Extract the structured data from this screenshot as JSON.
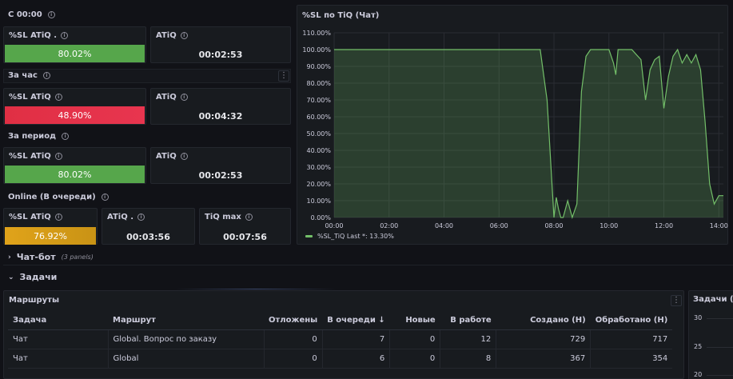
{
  "sections": {
    "now": {
      "title": "С 00:00"
    },
    "hour": {
      "title": "За час"
    },
    "period": {
      "title": "За период"
    },
    "online": {
      "title": "Online (В очереди)"
    }
  },
  "stats": {
    "now_sl": {
      "label": "%SL ATiQ .",
      "value": "80.02%",
      "color": "#56a64b"
    },
    "now_atiq": {
      "label": "ATiQ",
      "value": "00:02:53"
    },
    "hour_sl": {
      "label": "%SL ATiQ",
      "value": "48.90%",
      "color": "#e02f44"
    },
    "hour_atiq": {
      "label": "ATiQ",
      "value": "00:04:32"
    },
    "period_sl": {
      "label": "%SL ATiQ",
      "value": "80.02%",
      "color": "#56a64b"
    },
    "period_atiq": {
      "label": "ATiQ",
      "value": "00:02:53"
    },
    "online_sl": {
      "label": "%SL ATiQ",
      "value": "76.92%",
      "color": "#e0a31a"
    },
    "online_atiq": {
      "label": "ATiQ .",
      "value": "00:03:56"
    },
    "online_tiqmax": {
      "label": "TiQ max",
      "value": "00:07:56"
    }
  },
  "chart_panel": {
    "title": "%SL по TiQ (Чат)",
    "legend": "%SL_TiQ  Last *: 13.30%"
  },
  "chart_data": {
    "type": "area",
    "series": [
      {
        "name": "%SL_TiQ",
        "color": "#73bf69"
      }
    ],
    "x": [
      "00:00",
      "00:30",
      "01:00",
      "01:30",
      "02:00",
      "02:30",
      "03:00",
      "03:30",
      "04:00",
      "04:30",
      "05:00",
      "05:30",
      "06:00",
      "06:30",
      "07:00",
      "07:30",
      "07:45",
      "08:00",
      "08:05",
      "08:10",
      "08:15",
      "08:20",
      "08:30",
      "08:40",
      "08:50",
      "09:00",
      "09:10",
      "09:20",
      "09:30",
      "09:40",
      "09:50",
      "10:00",
      "10:10",
      "10:15",
      "10:20",
      "10:30",
      "10:40",
      "10:50",
      "11:00",
      "11:10",
      "11:20",
      "11:30",
      "11:40",
      "11:50",
      "12:00",
      "12:10",
      "12:20",
      "12:30",
      "12:40",
      "12:50",
      "13:00",
      "13:10",
      "13:20",
      "13:30",
      "13:40",
      "13:50",
      "14:00",
      "14:10"
    ],
    "y": [
      100,
      100,
      100,
      100,
      100,
      100,
      100,
      100,
      100,
      100,
      100,
      100,
      100,
      100,
      100,
      100,
      70,
      0,
      12,
      5,
      0,
      0,
      10,
      0,
      8,
      75,
      96,
      100,
      100,
      100,
      100,
      100,
      92,
      85,
      100,
      100,
      100,
      100,
      97,
      94,
      70,
      88,
      94,
      96,
      65,
      84,
      96,
      100,
      92,
      97,
      92,
      97,
      88,
      57,
      20,
      8,
      13,
      13
    ],
    "y_ticks": [
      "0.00%",
      "10.00%",
      "20.00%",
      "30.00%",
      "40.00%",
      "50.00%",
      "60.00%",
      "70.00%",
      "80.00%",
      "90.00%",
      "100.00%",
      "110.00%"
    ],
    "x_ticks": [
      "00:00",
      "02:00",
      "04:00",
      "06:00",
      "08:00",
      "10:00",
      "12:00",
      "14:00"
    ],
    "ylim": [
      0,
      110
    ],
    "grid": true
  },
  "rows": {
    "chatbot": {
      "title": "Чат-бот",
      "meta": "(3 panels)"
    },
    "tasks": {
      "title": "Задачи"
    }
  },
  "routes": {
    "title": "Маршруты",
    "columns": [
      "Задача",
      "Маршрут",
      "Отложены",
      "В очереди",
      "Новые",
      "В работе",
      "Создано (Н)",
      "Обработано (Н)"
    ],
    "rows": [
      [
        "Чат",
        "Global. Вопрос по заказу",
        "0",
        "7",
        "0",
        "12",
        "729",
        "717"
      ],
      [
        "Чат",
        "Global",
        "0",
        "6",
        "0",
        "8",
        "367",
        "354"
      ]
    ]
  },
  "side_panel": {
    "title": "Задачи (Ча",
    "ticks": [
      "30",
      "25",
      "20"
    ]
  },
  "icons": {
    "info": "info-icon",
    "menu": "menu-dots-icon",
    "sort": "arrow-down-icon",
    "chevron_right": "chevron-right-icon",
    "chevron_down": "chevron-down-icon"
  }
}
